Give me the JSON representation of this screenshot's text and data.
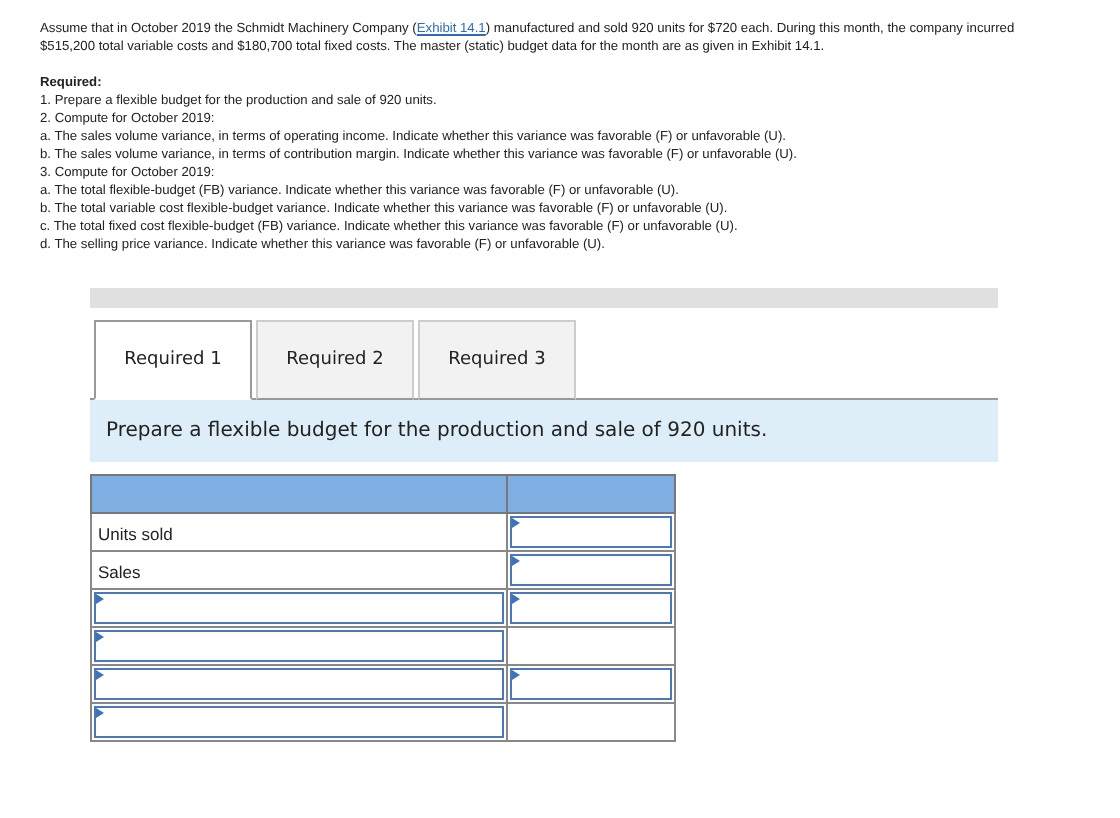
{
  "intro": "Assume that in October 2019 the Schmidt Machinery Company (",
  "intro_link": "Exhibit 14.1",
  "intro_rest": ") manufactured and sold 920 units for $720 each. During this month, the company incurred $515,200 total variable costs and $180,700 total fixed costs. The master (static) budget data for the month are as given in Exhibit 14.1.",
  "required_heading": "Required:",
  "required_items": [
    "1. Prepare a flexible budget for the production and sale of 920 units.",
    "2. Compute for October 2019:",
    "a. The sales volume variance, in terms of operating income. Indicate whether this variance was favorable (F) or unfavorable (U).",
    "b. The sales volume variance, in terms of contribution margin. Indicate whether this variance was favorable (F) or unfavorable (U).",
    "3. Compute for October 2019:",
    "a. The total flexible-budget (FB) variance. Indicate whether this variance was favorable (F) or unfavorable (U).",
    "b. The total variable cost flexible-budget variance. Indicate whether this variance was favorable (F) or unfavorable (U).",
    "c. The total fixed cost flexible-budget (FB) variance. Indicate whether this variance was favorable (F) or unfavorable (U).",
    "d. The selling price variance. Indicate whether this variance was favorable (F) or unfavorable (U)."
  ],
  "tabs": [
    {
      "label": "Required 1",
      "selected": true
    },
    {
      "label": "Required 2",
      "selected": false
    },
    {
      "label": "Required 3",
      "selected": false
    }
  ],
  "instruction": "Prepare a flexible budget for the production and sale of 920 units.",
  "table_rows": [
    {
      "cells": [
        {
          "kind": "text",
          "text": "Units sold"
        },
        {
          "kind": "input"
        }
      ]
    },
    {
      "cells": [
        {
          "kind": "text",
          "text": "Sales"
        },
        {
          "kind": "input"
        }
      ]
    },
    {
      "cells": [
        {
          "kind": "select"
        },
        {
          "kind": "input"
        }
      ]
    },
    {
      "cells": [
        {
          "kind": "select"
        },
        {
          "kind": "empty"
        }
      ]
    },
    {
      "cells": [
        {
          "kind": "select"
        },
        {
          "kind": "input"
        }
      ]
    },
    {
      "cells": [
        {
          "kind": "select"
        },
        {
          "kind": "empty"
        }
      ]
    }
  ]
}
